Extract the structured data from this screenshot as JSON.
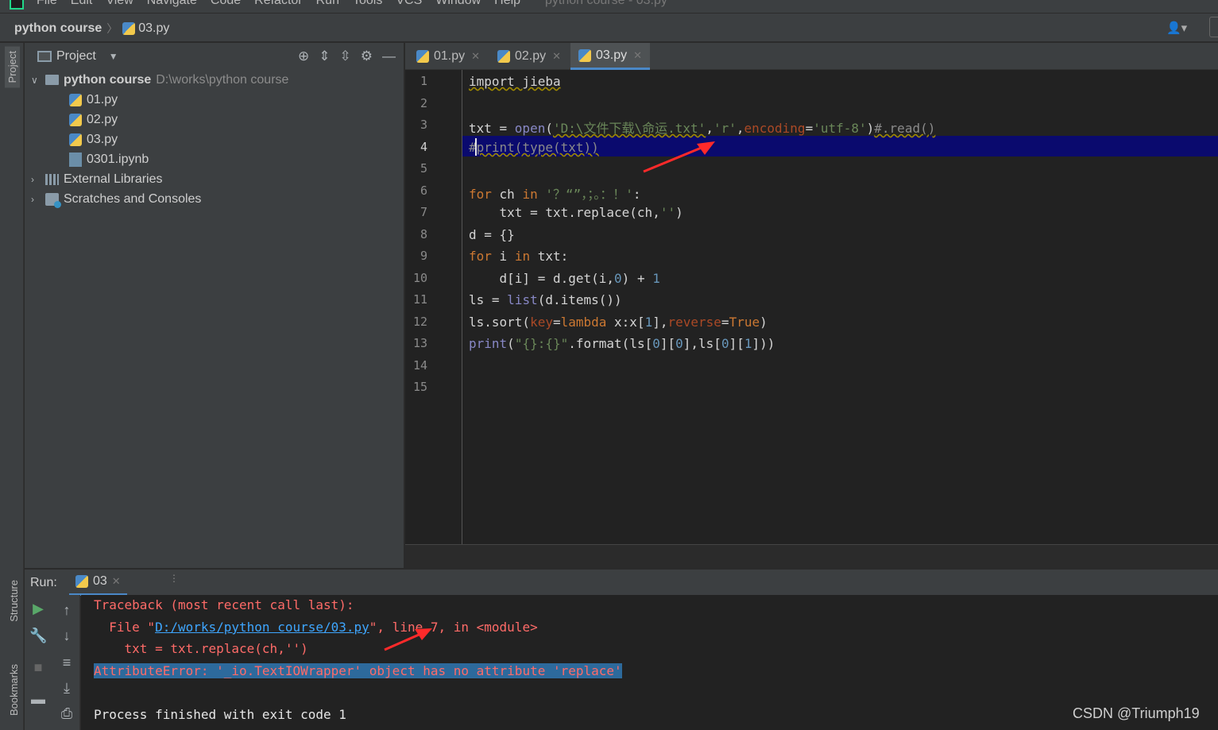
{
  "menubar": {
    "items": [
      "File",
      "Edit",
      "View",
      "Navigate",
      "Code",
      "Refactor",
      "Run",
      "Tools",
      "VCS",
      "Window",
      "Help"
    ],
    "window_title": "python course - 03.py"
  },
  "navbar": {
    "project": "python course",
    "file": "03.py"
  },
  "leftstrip": {
    "project_tab": "Project",
    "structure_tab": "Structure",
    "bookmarks_tab": "Bookmarks"
  },
  "project_panel": {
    "title": "Project",
    "tree": {
      "root_name": "python course",
      "root_path": "D:\\works\\python course",
      "files": [
        "01.py",
        "02.py",
        "03.py",
        "0301.ipynb"
      ],
      "external": "External Libraries",
      "scratches": "Scratches and Consoles"
    }
  },
  "tabs": [
    "01.py",
    "02.py",
    "03.py"
  ],
  "active_tab": "03.py",
  "editor": {
    "current_line": 4,
    "line_numbers": [
      "1",
      "2",
      "3",
      "4",
      "5",
      "6",
      "7",
      "8",
      "9",
      "10",
      "11",
      "12",
      "13",
      "14",
      "15"
    ]
  },
  "run_panel": {
    "label": "Run:",
    "tab": "03",
    "console": {
      "traceback": "Traceback (most recent call last):",
      "file_prefix": "  File \"",
      "file_link": "D:/works/python course/03.py",
      "file_suffix": "\", line 7, in <module>",
      "code": "    txt = txt.replace(ch,'')",
      "error": "AttributeError: '_io.TextIOWrapper' object has no attribute 'replace'",
      "finished": "Process finished with exit code 1"
    }
  },
  "watermark": "CSDN @Triumph19",
  "colors": {
    "highlight_line": "#0a0a6e",
    "error_text": "#ff6b68",
    "error_highlight": "#2d6a9c",
    "keyword": "#cc7832",
    "string": "#6a8759",
    "number": "#6897bb",
    "accent": "#4a88c7"
  },
  "icons": {
    "locate": "crosshair-icon",
    "expand": "expand-all-icon",
    "collapse": "collapse-all-icon",
    "settings": "gear-icon",
    "hide": "minus-icon"
  }
}
